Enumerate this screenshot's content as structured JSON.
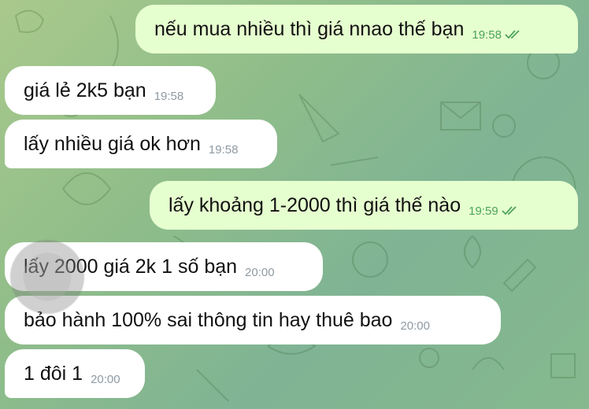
{
  "messages": [
    {
      "text": "nếu mua nhiều thì giá nnao thế bạn",
      "time": "19:58",
      "direction": "outgoing",
      "status": "read"
    },
    {
      "text": "giá lẻ 2k5 bạn",
      "time": "19:58",
      "direction": "incoming"
    },
    {
      "text": "lấy nhiều giá ok hơn",
      "time": "19:58",
      "direction": "incoming"
    },
    {
      "text": "lấy khoảng 1-2000 thì giá thế nào",
      "time": "19:59",
      "direction": "outgoing",
      "status": "read"
    },
    {
      "text": "lấy 2000 giá 2k 1 số bạn",
      "time": "20:00",
      "direction": "incoming"
    },
    {
      "text": "bảo hành 100% sai thông tin hay thuê bao",
      "time": "20:00",
      "direction": "incoming"
    },
    {
      "text": "1 đôi 1",
      "time": "20:00",
      "direction": "incoming"
    }
  ],
  "colors": {
    "incoming_bubble": "#ffffff",
    "outgoing_bubble": "#e6ffcf",
    "outgoing_time": "#4da35a",
    "incoming_time": "#8e9aa3"
  },
  "icons": [
    "double-check-icon"
  ]
}
